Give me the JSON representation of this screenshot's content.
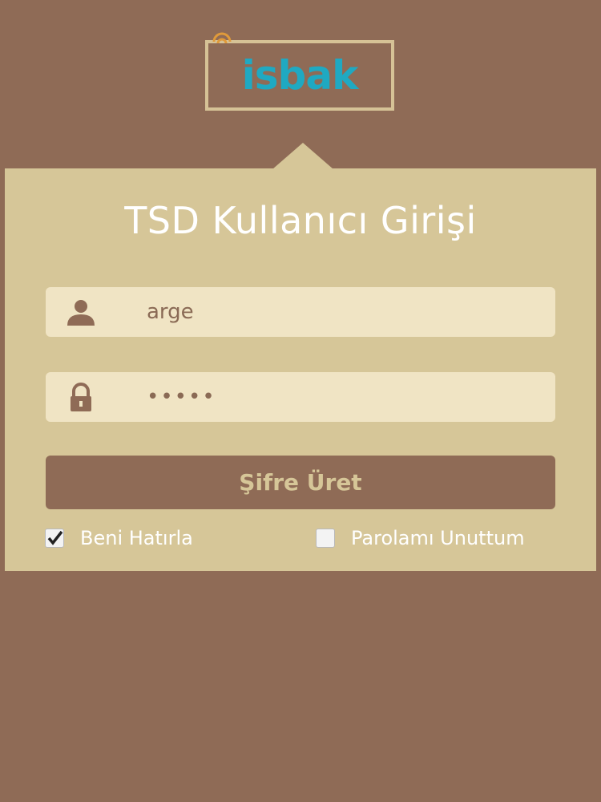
{
  "logo": {
    "text": "isbak",
    "brand_color": "#1fa9c2"
  },
  "title": "TSD Kullanıcı Girişi",
  "username": {
    "value": "arge",
    "icon": "user-icon"
  },
  "password": {
    "value": "•••••",
    "icon": "lock-icon"
  },
  "submit_label": "Şifre Üret",
  "remember": {
    "label": "Beni Hatırla",
    "checked": true
  },
  "forgot": {
    "label": "Parolamı Unuttum",
    "checked": false
  },
  "colors": {
    "background": "#8f6b56",
    "panel": "#d6c698",
    "field": "#f0e4c4"
  }
}
